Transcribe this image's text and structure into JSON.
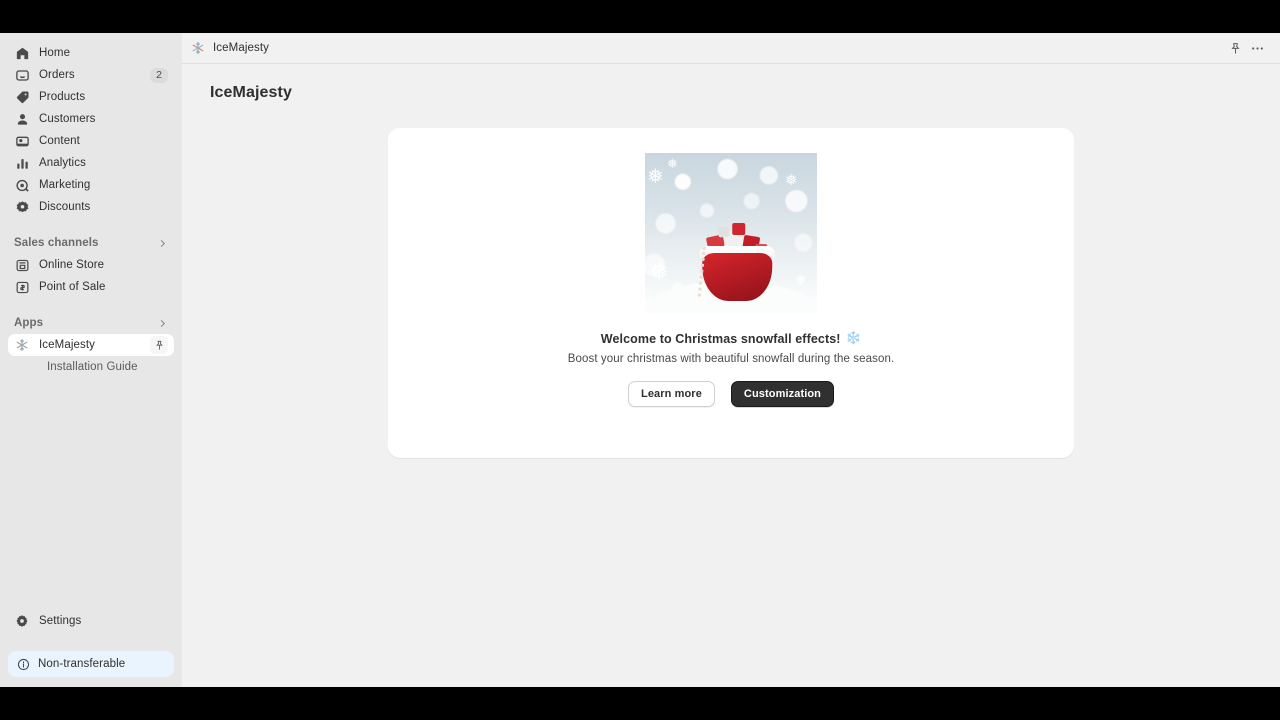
{
  "sidebar": {
    "primary_items": [
      {
        "label": "Home",
        "icon": "home-icon",
        "badge": null
      },
      {
        "label": "Orders",
        "icon": "orders-icon",
        "badge": "2"
      },
      {
        "label": "Products",
        "icon": "products-tag-icon",
        "badge": null
      },
      {
        "label": "Customers",
        "icon": "customers-person-icon",
        "badge": null
      },
      {
        "label": "Content",
        "icon": "content-icon",
        "badge": null
      },
      {
        "label": "Analytics",
        "icon": "analytics-bar-chart-icon",
        "badge": null
      },
      {
        "label": "Marketing",
        "icon": "marketing-target-icon",
        "badge": null
      },
      {
        "label": "Discounts",
        "icon": "discounts-icon",
        "badge": null
      }
    ],
    "sales_channels": {
      "title": "Sales channels",
      "items": [
        {
          "label": "Online Store",
          "icon": "online-store-icon"
        },
        {
          "label": "Point of Sale",
          "icon": "point-of-sale-icon"
        }
      ]
    },
    "apps": {
      "title": "Apps",
      "items": [
        {
          "label": "IceMajesty",
          "icon": "snowflake-icon",
          "active": true,
          "pin": "pin-icon"
        }
      ],
      "sub_items": [
        {
          "label": "Installation Guide"
        }
      ]
    },
    "settings": {
      "label": "Settings",
      "icon": "gear-icon"
    },
    "notice": {
      "label": "Non-transferable",
      "icon": "info-icon",
      "background": "#eaf4fe"
    }
  },
  "topbar": {
    "app_icon": "snowflake-icon",
    "app_name": "IceMajesty",
    "pin_button": "pin-icon",
    "more_button": "ellipsis-icon"
  },
  "page": {
    "title": "IceMajesty"
  },
  "welcome_card": {
    "hero_alt": "christmas-gift-sack-snowfall-image",
    "title": "Welcome to Christmas snowfall effects!",
    "title_emoji": "❄️",
    "subtitle": "Boost your christmas with beautiful snowfall during the season.",
    "secondary_button": "Learn more",
    "primary_button": "Customization"
  },
  "colors": {
    "sidebar_bg": "#e7e7e7",
    "main_bg": "#f1f1f1",
    "card_bg": "#ffffff",
    "primary_button_bg": "#303030",
    "notice_bg": "#eaf4fe",
    "letterbox": "#000000"
  }
}
